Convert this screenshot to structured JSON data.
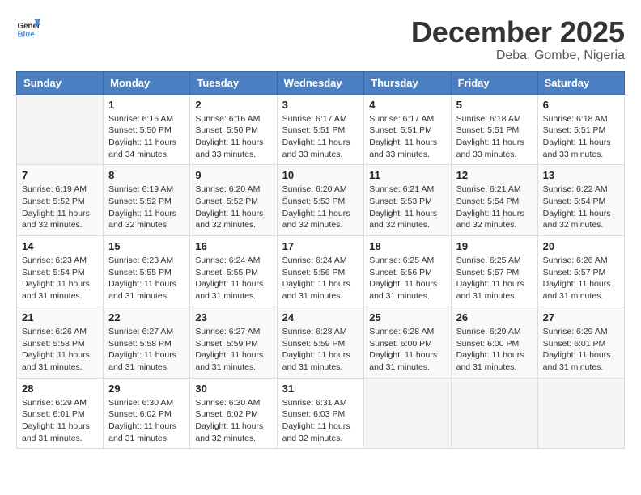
{
  "header": {
    "logo_general": "General",
    "logo_blue": "Blue",
    "month_title": "December 2025",
    "location": "Deba, Gombe, Nigeria"
  },
  "days_of_week": [
    "Sunday",
    "Monday",
    "Tuesday",
    "Wednesday",
    "Thursday",
    "Friday",
    "Saturday"
  ],
  "weeks": [
    [
      {
        "day": "",
        "sunrise": "",
        "sunset": "",
        "daylight": ""
      },
      {
        "day": "1",
        "sunrise": "Sunrise: 6:16 AM",
        "sunset": "Sunset: 5:50 PM",
        "daylight": "Daylight: 11 hours and 34 minutes."
      },
      {
        "day": "2",
        "sunrise": "Sunrise: 6:16 AM",
        "sunset": "Sunset: 5:50 PM",
        "daylight": "Daylight: 11 hours and 33 minutes."
      },
      {
        "day": "3",
        "sunrise": "Sunrise: 6:17 AM",
        "sunset": "Sunset: 5:51 PM",
        "daylight": "Daylight: 11 hours and 33 minutes."
      },
      {
        "day": "4",
        "sunrise": "Sunrise: 6:17 AM",
        "sunset": "Sunset: 5:51 PM",
        "daylight": "Daylight: 11 hours and 33 minutes."
      },
      {
        "day": "5",
        "sunrise": "Sunrise: 6:18 AM",
        "sunset": "Sunset: 5:51 PM",
        "daylight": "Daylight: 11 hours and 33 minutes."
      },
      {
        "day": "6",
        "sunrise": "Sunrise: 6:18 AM",
        "sunset": "Sunset: 5:51 PM",
        "daylight": "Daylight: 11 hours and 33 minutes."
      }
    ],
    [
      {
        "day": "7",
        "sunrise": "Sunrise: 6:19 AM",
        "sunset": "Sunset: 5:52 PM",
        "daylight": "Daylight: 11 hours and 32 minutes."
      },
      {
        "day": "8",
        "sunrise": "Sunrise: 6:19 AM",
        "sunset": "Sunset: 5:52 PM",
        "daylight": "Daylight: 11 hours and 32 minutes."
      },
      {
        "day": "9",
        "sunrise": "Sunrise: 6:20 AM",
        "sunset": "Sunset: 5:52 PM",
        "daylight": "Daylight: 11 hours and 32 minutes."
      },
      {
        "day": "10",
        "sunrise": "Sunrise: 6:20 AM",
        "sunset": "Sunset: 5:53 PM",
        "daylight": "Daylight: 11 hours and 32 minutes."
      },
      {
        "day": "11",
        "sunrise": "Sunrise: 6:21 AM",
        "sunset": "Sunset: 5:53 PM",
        "daylight": "Daylight: 11 hours and 32 minutes."
      },
      {
        "day": "12",
        "sunrise": "Sunrise: 6:21 AM",
        "sunset": "Sunset: 5:54 PM",
        "daylight": "Daylight: 11 hours and 32 minutes."
      },
      {
        "day": "13",
        "sunrise": "Sunrise: 6:22 AM",
        "sunset": "Sunset: 5:54 PM",
        "daylight": "Daylight: 11 hours and 32 minutes."
      }
    ],
    [
      {
        "day": "14",
        "sunrise": "Sunrise: 6:23 AM",
        "sunset": "Sunset: 5:54 PM",
        "daylight": "Daylight: 11 hours and 31 minutes."
      },
      {
        "day": "15",
        "sunrise": "Sunrise: 6:23 AM",
        "sunset": "Sunset: 5:55 PM",
        "daylight": "Daylight: 11 hours and 31 minutes."
      },
      {
        "day": "16",
        "sunrise": "Sunrise: 6:24 AM",
        "sunset": "Sunset: 5:55 PM",
        "daylight": "Daylight: 11 hours and 31 minutes."
      },
      {
        "day": "17",
        "sunrise": "Sunrise: 6:24 AM",
        "sunset": "Sunset: 5:56 PM",
        "daylight": "Daylight: 11 hours and 31 minutes."
      },
      {
        "day": "18",
        "sunrise": "Sunrise: 6:25 AM",
        "sunset": "Sunset: 5:56 PM",
        "daylight": "Daylight: 11 hours and 31 minutes."
      },
      {
        "day": "19",
        "sunrise": "Sunrise: 6:25 AM",
        "sunset": "Sunset: 5:57 PM",
        "daylight": "Daylight: 11 hours and 31 minutes."
      },
      {
        "day": "20",
        "sunrise": "Sunrise: 6:26 AM",
        "sunset": "Sunset: 5:57 PM",
        "daylight": "Daylight: 11 hours and 31 minutes."
      }
    ],
    [
      {
        "day": "21",
        "sunrise": "Sunrise: 6:26 AM",
        "sunset": "Sunset: 5:58 PM",
        "daylight": "Daylight: 11 hours and 31 minutes."
      },
      {
        "day": "22",
        "sunrise": "Sunrise: 6:27 AM",
        "sunset": "Sunset: 5:58 PM",
        "daylight": "Daylight: 11 hours and 31 minutes."
      },
      {
        "day": "23",
        "sunrise": "Sunrise: 6:27 AM",
        "sunset": "Sunset: 5:59 PM",
        "daylight": "Daylight: 11 hours and 31 minutes."
      },
      {
        "day": "24",
        "sunrise": "Sunrise: 6:28 AM",
        "sunset": "Sunset: 5:59 PM",
        "daylight": "Daylight: 11 hours and 31 minutes."
      },
      {
        "day": "25",
        "sunrise": "Sunrise: 6:28 AM",
        "sunset": "Sunset: 6:00 PM",
        "daylight": "Daylight: 11 hours and 31 minutes."
      },
      {
        "day": "26",
        "sunrise": "Sunrise: 6:29 AM",
        "sunset": "Sunset: 6:00 PM",
        "daylight": "Daylight: 11 hours and 31 minutes."
      },
      {
        "day": "27",
        "sunrise": "Sunrise: 6:29 AM",
        "sunset": "Sunset: 6:01 PM",
        "daylight": "Daylight: 11 hours and 31 minutes."
      }
    ],
    [
      {
        "day": "28",
        "sunrise": "Sunrise: 6:29 AM",
        "sunset": "Sunset: 6:01 PM",
        "daylight": "Daylight: 11 hours and 31 minutes."
      },
      {
        "day": "29",
        "sunrise": "Sunrise: 6:30 AM",
        "sunset": "Sunset: 6:02 PM",
        "daylight": "Daylight: 11 hours and 31 minutes."
      },
      {
        "day": "30",
        "sunrise": "Sunrise: 6:30 AM",
        "sunset": "Sunset: 6:02 PM",
        "daylight": "Daylight: 11 hours and 32 minutes."
      },
      {
        "day": "31",
        "sunrise": "Sunrise: 6:31 AM",
        "sunset": "Sunset: 6:03 PM",
        "daylight": "Daylight: 11 hours and 32 minutes."
      },
      {
        "day": "",
        "sunrise": "",
        "sunset": "",
        "daylight": ""
      },
      {
        "day": "",
        "sunrise": "",
        "sunset": "",
        "daylight": ""
      },
      {
        "day": "",
        "sunrise": "",
        "sunset": "",
        "daylight": ""
      }
    ]
  ]
}
